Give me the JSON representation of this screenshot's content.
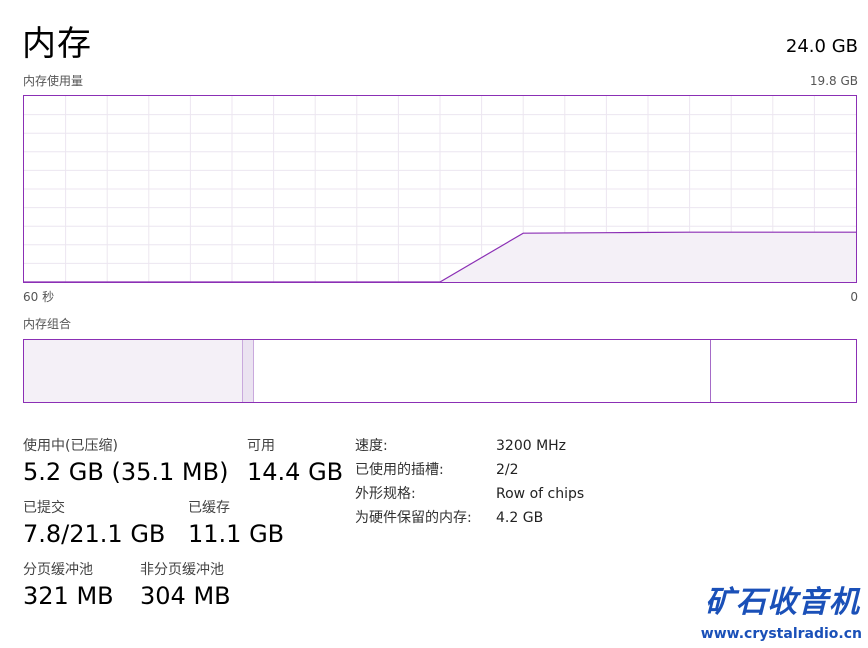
{
  "header": {
    "title": "内存",
    "total_memory": "24.0 GB"
  },
  "usage_chart": {
    "label": "内存使用量",
    "max_label": "19.8 GB",
    "x_left_label": "60 秒",
    "x_right_label": "0",
    "line_color": "#8b2fb5",
    "fill_color": "#f4f0f7"
  },
  "chart_data": {
    "type": "area",
    "title": "内存使用量",
    "x": [
      60,
      54,
      48,
      42,
      36,
      30,
      24,
      18,
      12,
      6,
      0
    ],
    "xlabel": "",
    "ylabel": "",
    "ylim": [
      0,
      19.8
    ],
    "y_unit": "GB",
    "x_tick_labels": [
      "60 秒",
      "0"
    ],
    "series": [
      {
        "values": [
          0,
          0,
          0,
          0,
          0,
          0,
          5.2,
          5.25,
          5.3,
          5.3,
          5.3
        ]
      }
    ],
    "grid": true
  },
  "composition": {
    "label": "内存组合"
  },
  "stats": {
    "in_use_label": "使用中(已压缩)",
    "in_use_value": "5.2 GB (35.1 MB)",
    "available_label": "可用",
    "available_value": "14.4 GB",
    "committed_label": "已提交",
    "committed_value": "7.8/21.1 GB",
    "cached_label": "已缓存",
    "cached_value": "11.1 GB",
    "paged_pool_label": "分页缓冲池",
    "paged_pool_value": "321 MB",
    "nonpaged_pool_label": "非分页缓冲池",
    "nonpaged_pool_value": "304 MB"
  },
  "specs": {
    "speed_label": "速度:",
    "speed_value": "3200 MHz",
    "slots_label": "已使用的插槽:",
    "slots_value": "2/2",
    "form_label": "外形规格:",
    "form_value": "Row of chips",
    "reserved_label": "为硬件保留的内存:",
    "reserved_value": "4.2 GB"
  },
  "watermark": {
    "brand": "矿石收音机",
    "url": "www.crystalradio.cn"
  }
}
